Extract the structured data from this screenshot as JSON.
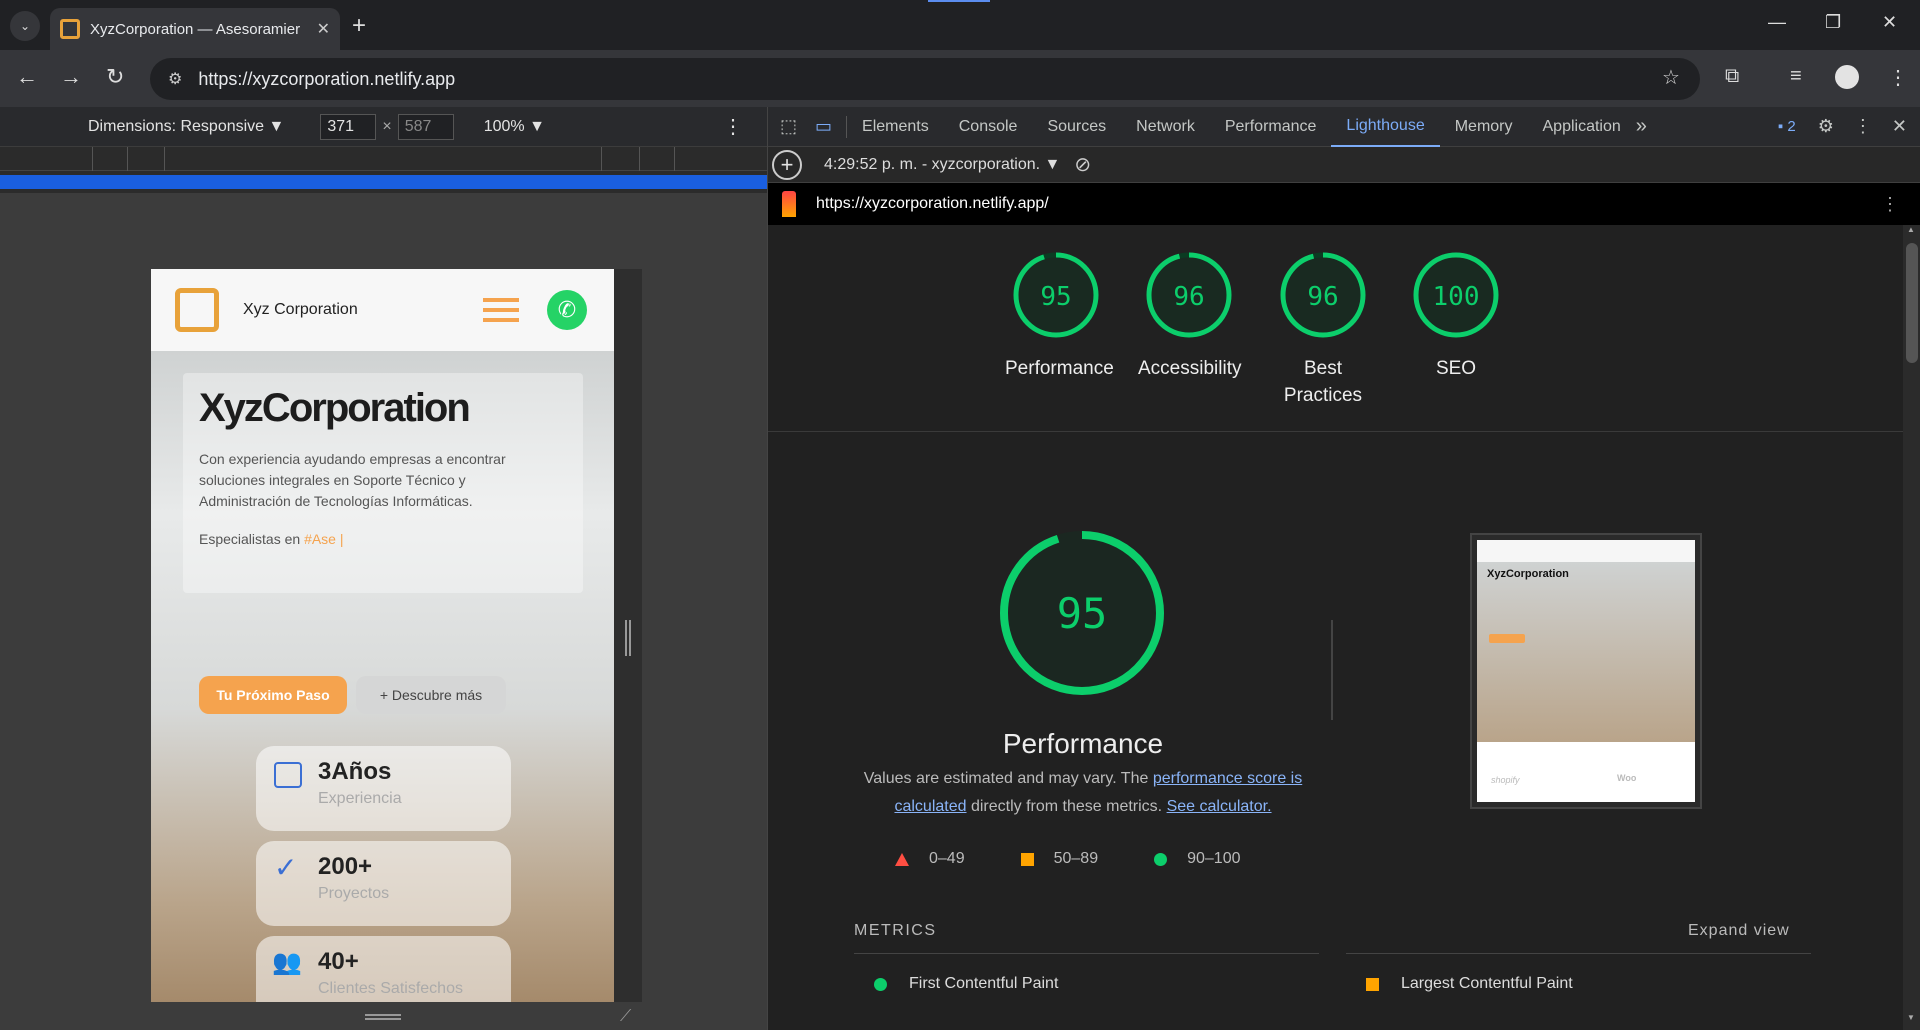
{
  "browser": {
    "tab_title": "XyzCorporation — Asesoramier",
    "url": "https://xyzcorporation.netlify.app"
  },
  "device_toolbar": {
    "dimensions_label": "Dimensions: Responsive ▼",
    "width": "371",
    "times": "×",
    "height": "587",
    "zoom": "100% ▼"
  },
  "site": {
    "brand": "Xyz Corporation",
    "hero_title": "XyzCorporation",
    "hero_text": "Con experiencia ayudando empresas a encontrar soluciones integrales en Soporte Técnico y Administración de Tecnologías Informáticas.",
    "specialists_prefix": "Especialistas en",
    "specialists_typed": "#Ase |",
    "cta_primary": "Tu Próximo Paso",
    "cta_secondary": "+ Descubre más",
    "stats": [
      {
        "num": "3Años",
        "label": "Experiencia"
      },
      {
        "num": "200+",
        "label": "Proyectos"
      },
      {
        "num": "40+",
        "label": "Clientes Satisfechos"
      }
    ]
  },
  "devtools": {
    "tabs": [
      "Elements",
      "Console",
      "Sources",
      "Network",
      "Performance",
      "Lighthouse",
      "Memory",
      "Application"
    ],
    "active_tab": "Lighthouse",
    "more": "»",
    "issues_count": "2",
    "report_select": "4:29:52 p. m. - xyzcorporation. ▼",
    "report_url": "https://xyzcorporation.netlify.app/"
  },
  "lighthouse": {
    "scores": [
      {
        "value": 95,
        "label": "Performance"
      },
      {
        "value": 96,
        "label": "Accessibility"
      },
      {
        "value": 96,
        "label": "Best Practices"
      },
      {
        "value": 100,
        "label": "SEO"
      }
    ],
    "main_score": 95,
    "main_title": "Performance",
    "desc_prefix": "Values are estimated and may vary. The",
    "desc_link1": "performance score is calculated",
    "desc_middle": "directly from these metrics.",
    "desc_link2": "See calculator.",
    "legend": [
      {
        "range": "0–49",
        "color": "#ff4e42"
      },
      {
        "range": "50–89",
        "color": "#ffa400"
      },
      {
        "range": "90–100",
        "color": "#0cce6b"
      }
    ],
    "metrics_header": "METRICS",
    "expand": "Expand view",
    "metrics": [
      {
        "name": "First Contentful Paint",
        "status": "pass"
      },
      {
        "name": "Largest Contentful Paint",
        "status": "average"
      }
    ],
    "thumb_brand": "XyzCorporation",
    "thumb_logos": [
      "shopify",
      "Woo"
    ]
  },
  "colors": {
    "pass": "#0cce6b",
    "average": "#ffa400",
    "fail": "#ff4e42",
    "accent": "#f5a34e",
    "link": "#8ab4f8"
  }
}
